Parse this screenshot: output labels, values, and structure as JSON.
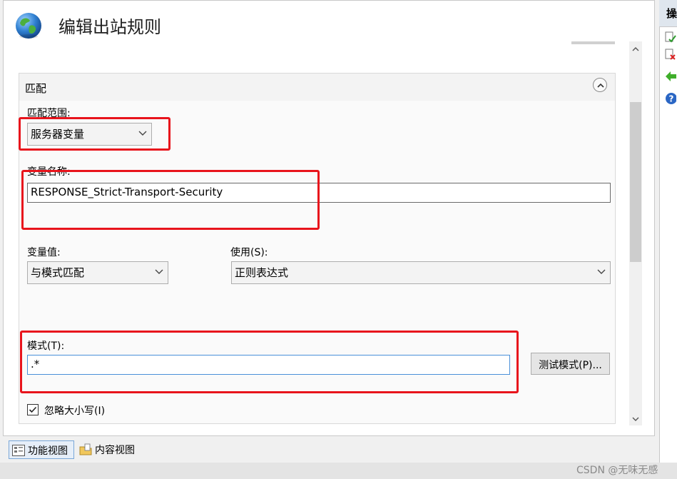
{
  "page": {
    "title": "编辑出站规则"
  },
  "actions_pane": {
    "header_label": "操",
    "icons": [
      "apply-icon",
      "cancel-icon",
      "back-icon",
      "help-icon"
    ]
  },
  "match_section": {
    "heading": "匹配",
    "collapse_icon": "chevron-up-icon",
    "scope_label": "匹配范围:",
    "scope_value": "服务器变量",
    "variable_name_label": "变量名称:",
    "variable_name_value": "RESPONSE_Strict-Transport-Security",
    "variable_value_label": "变量值:",
    "variable_value_selected": "与模式匹配",
    "using_label": "使用(S):",
    "using_selected": "正则表达式",
    "pattern_label": "模式(T):",
    "pattern_value": ".*",
    "test_pattern_label": "测试模式(P)...",
    "ignore_case_label": "忽略大小写(I)",
    "ignore_case_checked": true
  },
  "bottom_bar": {
    "features_view_label": "功能视图",
    "content_view_label": "内容视图"
  },
  "watermark": "CSDN @无味无感",
  "colors": {
    "highlight": "#e8141c",
    "focus_border": "#4a90d9"
  }
}
